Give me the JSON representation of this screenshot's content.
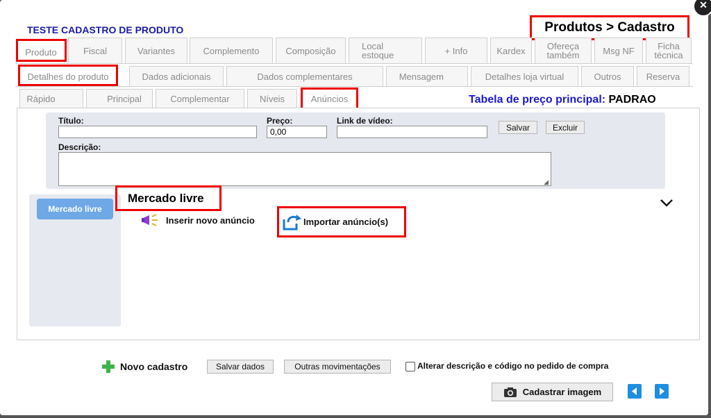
{
  "window": {
    "title": "TESTE CADASTRO DE PRODUTO",
    "breadcrumb": "Produtos > Cadastro"
  },
  "tabs_row1": [
    {
      "label": "Produto",
      "active": true
    },
    {
      "label": "Fiscal"
    },
    {
      "label": "Variantes"
    },
    {
      "label": "Complemento"
    },
    {
      "label": "Composição"
    },
    {
      "label": "Local estoque"
    },
    {
      "label": "+ Info"
    },
    {
      "label": "Kardex"
    },
    {
      "label": "Ofereça também"
    },
    {
      "label": "Msg NF"
    },
    {
      "label": "Ficha técnica"
    }
  ],
  "tabs_row2": [
    {
      "label": "Detalhes do produto",
      "active": true
    },
    {
      "label": "Dados adicionais"
    },
    {
      "label": "Dados complementares"
    },
    {
      "label": "Mensagem"
    },
    {
      "label": "Detalhes loja virtual"
    },
    {
      "label": "Outros"
    },
    {
      "label": "Reserva"
    }
  ],
  "tabs_row3": [
    {
      "label": "Rápido"
    },
    {
      "label": "Principal"
    },
    {
      "label": "Complementar"
    },
    {
      "label": "Níveis"
    },
    {
      "label": "Anúncios",
      "active": true
    }
  ],
  "price_table": {
    "label": "Tabela de preço principal:",
    "value": "PADRAO"
  },
  "form": {
    "titulo_label": "Título:",
    "titulo_value": "",
    "preco_label": "Preço:",
    "preco_value": "0,00",
    "link_label": "Link de vídeo:",
    "link_value": "",
    "descricao_label": "Descrição:",
    "descricao_value": "",
    "salvar": "Salvar",
    "excluir": "Excluir"
  },
  "marketplace": {
    "side_button": "Mercado livre",
    "title": "Mercado livre",
    "insert": "Inserir novo anúncio",
    "import": "Importar anúncio(s)"
  },
  "footer": {
    "novo": "Novo cadastro",
    "salvar": "Salvar dados",
    "outras": "Outras movimentações",
    "checkbox_label": "Alterar descrição e código no pedido de compra",
    "cadastrar_imagem": "Cadastrar imagem"
  },
  "colors": {
    "accent": "#1a1ad0",
    "highlight": "#ee0000",
    "side_button": "#6fa8e6",
    "arrow_blue": "#1e8ee0",
    "plus_green": "#3cb34a"
  }
}
